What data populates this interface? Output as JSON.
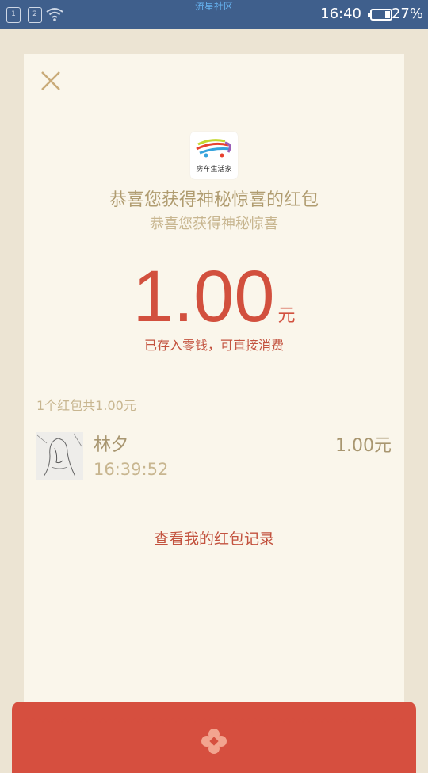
{
  "status_bar": {
    "sim1": "1",
    "sim2": "2",
    "carrier": "流星社区",
    "time": "16:40",
    "battery": "27%",
    "battery_level": 0.27,
    "icons": [
      "sim-card-icon",
      "sim-card-icon",
      "wifi-icon",
      "battery-icon"
    ]
  },
  "card": {
    "close_icon": "close-icon",
    "logo_text": "房车生活家",
    "title": "恭喜您获得神秘惊喜的红包",
    "subtitle": "恭喜您获得神秘惊喜",
    "amount": "1.00",
    "unit": "元",
    "saved_text": "已存入零钱，可直接消费",
    "summary": "1个红包共1.00元",
    "records": [
      {
        "name": "林夕",
        "time": "16:39:52",
        "amount": "1.00元"
      }
    ],
    "record_link": "查看我的红包记录"
  },
  "colors": {
    "status_bar": "#3f5f8c",
    "background": "#ece4d3",
    "card": "#faf6eb",
    "red": "#d64f3f",
    "gold": "#b09c70"
  }
}
